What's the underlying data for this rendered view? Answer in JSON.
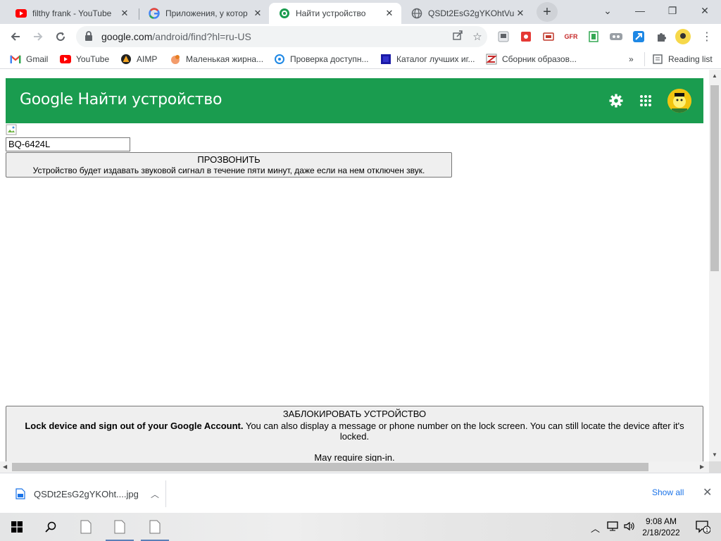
{
  "tabs": [
    {
      "title": "filthy frank - YouTube",
      "icon": "youtube-icon"
    },
    {
      "title": "Приложения, у котор",
      "icon": "google-icon"
    },
    {
      "title": "Найти устройство",
      "icon": "find-device-icon",
      "active": true
    },
    {
      "title": "QSDt2EsG2gYKOhtVu",
      "icon": "globe-icon"
    }
  ],
  "toolbar": {
    "url_host": "google.com",
    "url_path": "/android/find?hl=ru-US"
  },
  "bookmarks": [
    {
      "label": "Gmail",
      "icon": "gmail-icon"
    },
    {
      "label": "YouTube",
      "icon": "youtube-icon"
    },
    {
      "label": "AIMP",
      "icon": "aimp-icon"
    },
    {
      "label": "Маленькая жирна...",
      "icon": "bookmark-site-icon"
    },
    {
      "label": "Проверка доступн...",
      "icon": "bookmark-site-icon"
    },
    {
      "label": "Каталог лучших иг...",
      "icon": "bookmark-site-icon"
    },
    {
      "label": "Сборник образов...",
      "icon": "bookmark-site-icon"
    }
  ],
  "bookmarks_overflow": "»",
  "reading_list": "Reading list",
  "page": {
    "brand_google": "Google",
    "brand_service": "Найти устройство",
    "device_name": "BQ-6424L",
    "ring_title": "ПРОЗВОНИТЬ",
    "ring_desc": "Устройство будет издавать звуковой сигнал в течение пяти минут, даже если на нем отключен звук.",
    "lock_title": "ЗАБЛОКИРОВАТЬ УСТРОЙСТВО",
    "lock_bold": "Lock device and sign out of your Google Account.",
    "lock_desc": " You can also display a message or phone number on the lock screen. You can still locate the device after it's locked.",
    "lock_req": "May require sign-in."
  },
  "download": {
    "filename": "QSDt2EsG2gYKOht....jpg",
    "show_all": "Show all"
  },
  "taskbar": {
    "time": "9:08 AM",
    "date": "2/18/2022",
    "notification_count": "1"
  },
  "colors": {
    "header_green": "#1a9c4f",
    "tab_strip": "#dee1e6",
    "link_blue": "#1a73e8"
  }
}
